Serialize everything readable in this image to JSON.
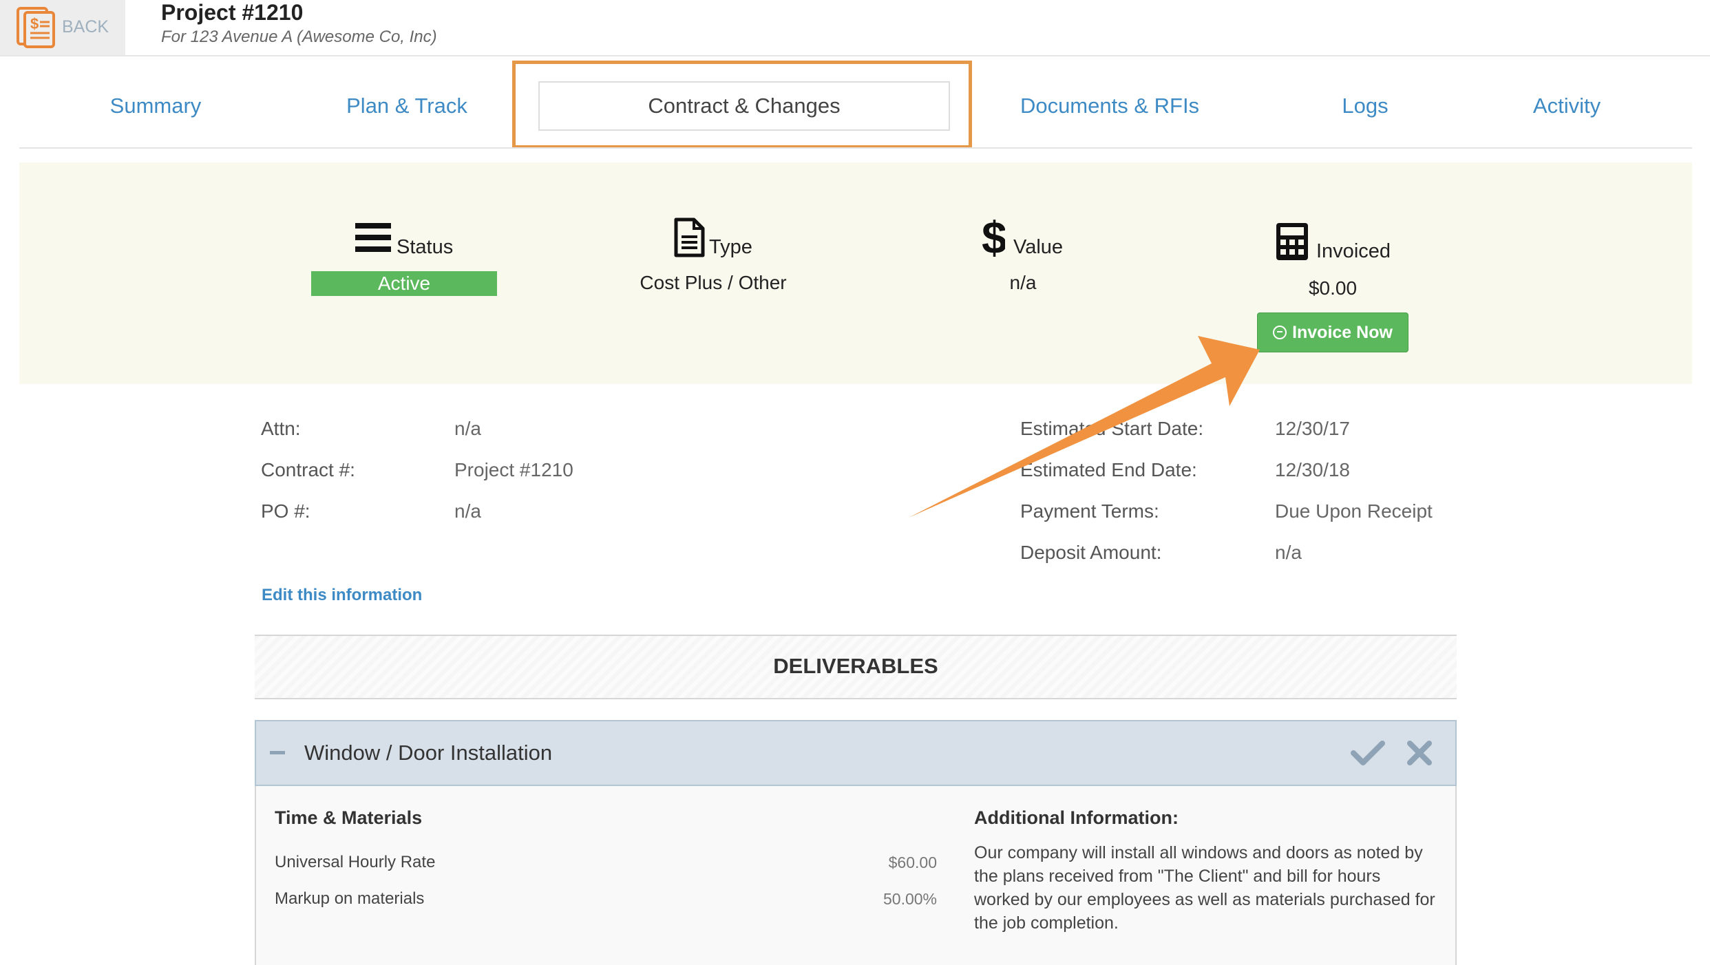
{
  "header": {
    "back_label": "BACK",
    "project_title": "Project #1210",
    "project_subtitle": "For 123 Avenue A (Awesome Co, Inc)"
  },
  "tabs": [
    {
      "label": "Summary"
    },
    {
      "label": "Plan & Track"
    },
    {
      "label": "Contract & Changes",
      "active": true
    },
    {
      "label": "Documents & RFIs"
    },
    {
      "label": "Logs"
    },
    {
      "label": "Activity"
    }
  ],
  "summary": {
    "status": {
      "label": "Status",
      "value": "Active",
      "icon": "list-icon"
    },
    "type": {
      "label": "Type",
      "value": "Cost Plus / Other",
      "icon": "document-icon"
    },
    "value": {
      "label": "Value",
      "value": "n/a",
      "icon": "dollar-icon"
    },
    "invoiced": {
      "label": "Invoiced",
      "value": "$0.00",
      "icon": "calculator-icon"
    },
    "invoice_button": "Invoice Now"
  },
  "contract_info": {
    "left": [
      {
        "label": "Attn:",
        "value": "n/a"
      },
      {
        "label": "Contract #:",
        "value": "Project #1210"
      },
      {
        "label": "PO #:",
        "value": "n/a"
      }
    ],
    "right": [
      {
        "label": "Estimated Start Date:",
        "value": "12/30/17"
      },
      {
        "label": "Estimated End Date:",
        "value": "12/30/18"
      },
      {
        "label": "Payment Terms:",
        "value": "Due Upon Receipt"
      },
      {
        "label": "Deposit Amount:",
        "value": "n/a"
      }
    ],
    "edit_link": "Edit this information"
  },
  "deliverables": {
    "title": "DELIVERABLES",
    "item": {
      "title": "Window / Door Installation",
      "pricing_heading": "Time & Materials",
      "rows": [
        {
          "label": "Universal Hourly Rate",
          "value": "$60.00"
        },
        {
          "label": "Markup on materials",
          "value": "50.00%"
        }
      ],
      "additional_heading": "Additional Information:",
      "additional_text": "Our company will install all windows and doors as noted by the plans received from \"The Client\" and bill for hours worked by our employees as well as materials purchased for the job completion."
    }
  },
  "colors": {
    "accent_blue": "#3d8ac4",
    "success_green": "#5cb85c",
    "highlight_orange": "#e59847",
    "panel_bg": "#faf9ee"
  }
}
